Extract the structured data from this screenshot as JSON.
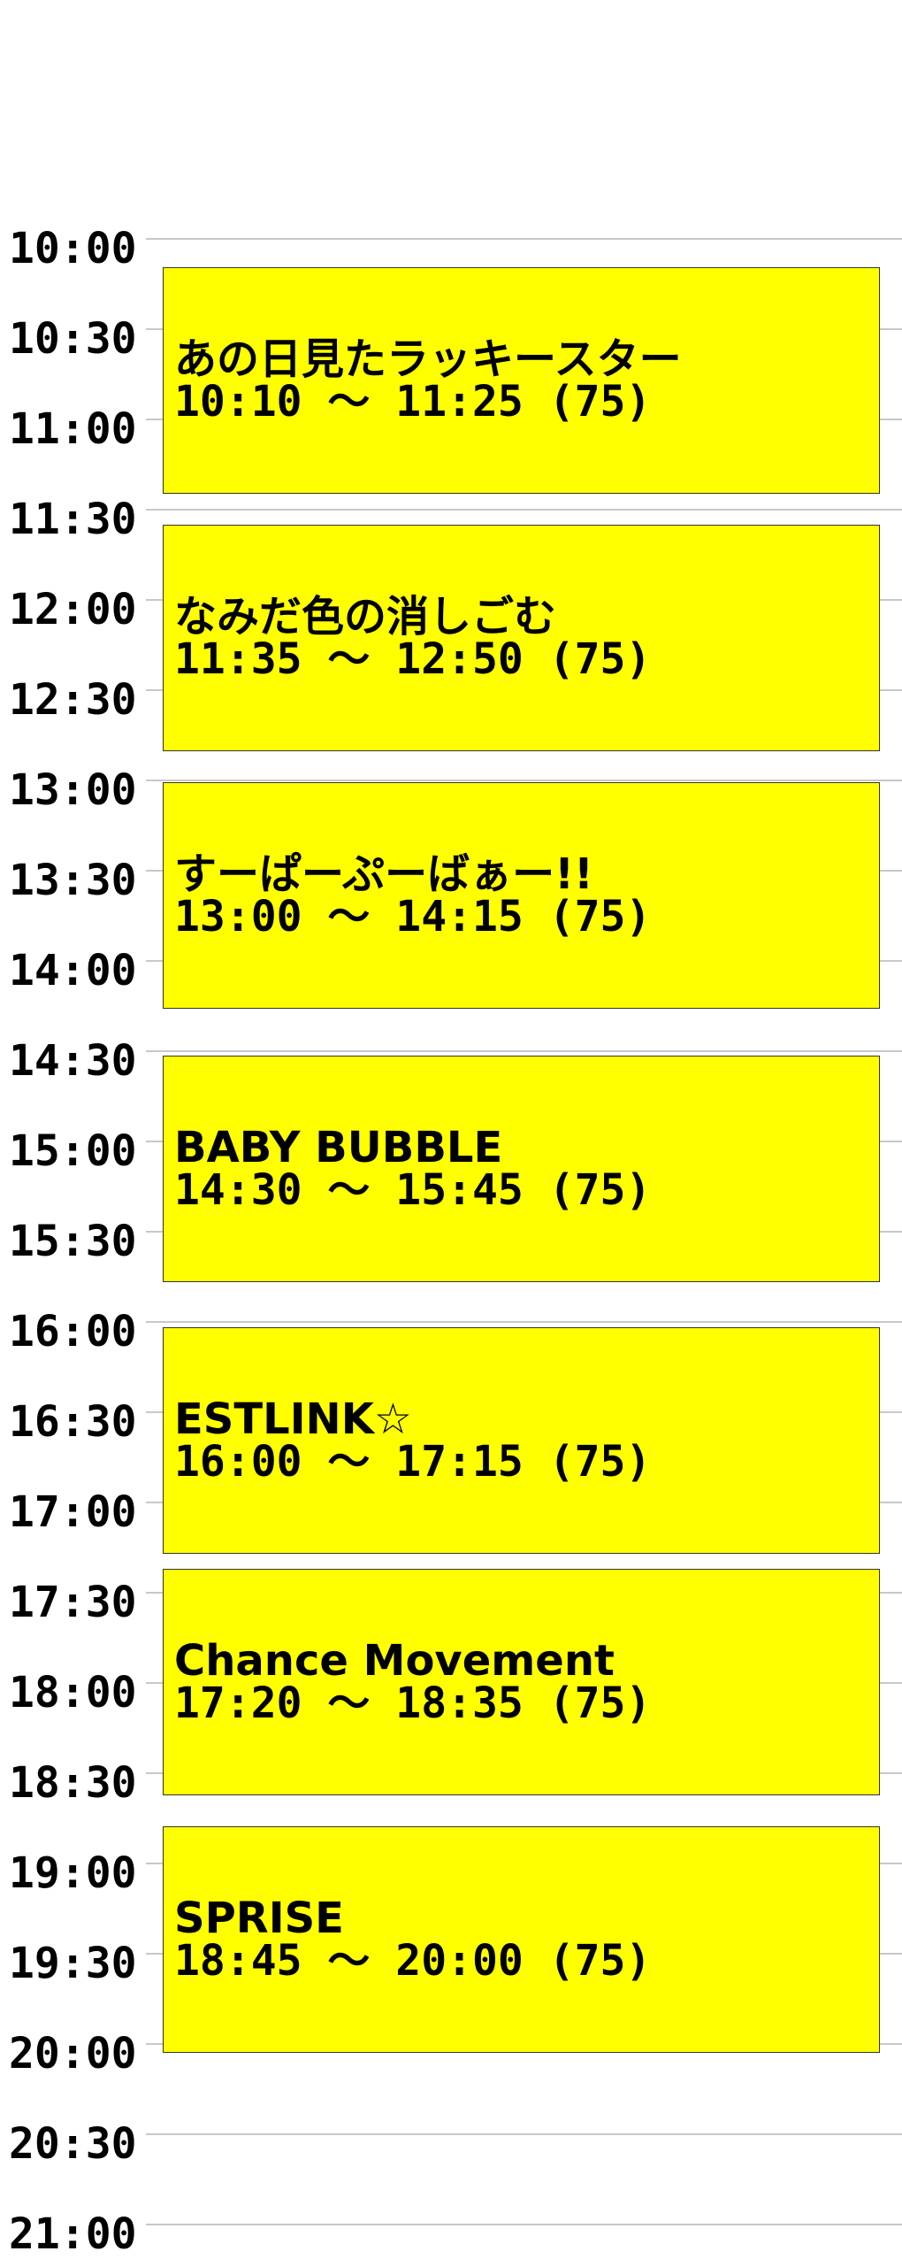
{
  "timeline": {
    "labels": [
      "10:00",
      "10:30",
      "11:00",
      "11:30",
      "12:00",
      "12:30",
      "13:00",
      "13:30",
      "14:00",
      "14:30",
      "15:00",
      "15:30",
      "16:00",
      "16:30",
      "17:00",
      "17:30",
      "18:00",
      "18:30",
      "19:00",
      "19:30",
      "20:00",
      "20:30",
      "21:00"
    ]
  },
  "slots": [
    {
      "name": "あの日見たラッキースター",
      "time": "10:10 ～ 11:25 (75)"
    },
    {
      "name": "なみだ色の消しごむ",
      "time": "11:35 ～ 12:50 (75)"
    },
    {
      "name": "すーぱーぷーばぁー!!",
      "time": "13:00 ～ 14:15 (75)"
    },
    {
      "name": "BABY BUBBLE",
      "time": "14:30 ～ 15:45 (75)"
    },
    {
      "name": "ESTLINK☆",
      "time": "16:00 ～ 17:15 (75)"
    },
    {
      "name": "Chance Movement",
      "time": "17:20 ～ 18:35 (75)"
    },
    {
      "name": "SPRISE",
      "time": "18:45 ～ 20:00 (75)"
    }
  ],
  "colors": {
    "slot_fill": "#ffff00",
    "grid": "#c8c8c8"
  }
}
